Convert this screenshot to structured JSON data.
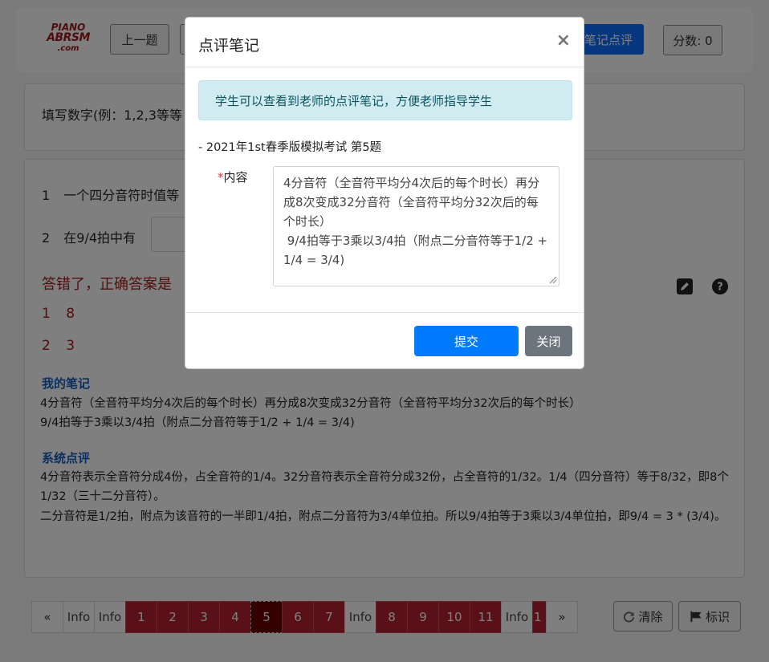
{
  "logo": {
    "line1": "PIANO",
    "line2": "ABRSM",
    "line3": ".com"
  },
  "toolbar": {
    "prev_label": "上一题",
    "notes_label": "笔记点评",
    "score_label": "分数: 0"
  },
  "question": {
    "instruction": "填写数字(例：1,2,3等等",
    "line1_num": "1",
    "line1_text": "一个四分音符时值等",
    "line2_num": "2",
    "line2_text": "在9/4拍中有",
    "wrong_text": "答错了，正确答案是",
    "answers": [
      "1 8",
      "2 3"
    ]
  },
  "notes": {
    "my_title": "我的笔记",
    "my_line1": "4分音符（全音符平均分4次后的每个时长）再分成8次变成32分音符（全音符平均分32次后的每个时长）",
    "my_line2": "9/4拍等于3乘以3/4拍（附点二分音符等于1/2 + 1/4 = 3/4)",
    "sys_title": "系统点评",
    "sys_line1": "4分音符表示全音符分成4份，占全音符的1/4。32分音符表示全音符分成32份，占全音符的1/32。1/4（四分音符）等于8/32，即8个1/32（三十二分音符）。",
    "sys_line2": "二分音符是1/2拍，附点为该音符的一半即1/4拍，附点二分音符为3/4单位拍。所以9/4拍等于3乘以3/4单位拍，即9/4 = 3 * (3/4)。"
  },
  "pager": {
    "prev": "«",
    "next": "»",
    "items": [
      "Info",
      "Info",
      "1",
      "2",
      "3",
      "4",
      "5",
      "6",
      "7",
      "Info",
      "8",
      "9",
      "10",
      "11",
      "Info",
      "1"
    ],
    "current": "5",
    "clear_label": "清除",
    "flag_label": "标识"
  },
  "modal": {
    "title": "点评笔记",
    "close": "×",
    "alert": "学生可以查看到老师的点评笔记，方便老师指导学生",
    "subtitle": "- 2021年1st春季版模拟考试 第5题",
    "field_star": "*",
    "field_label": "内容",
    "content": "4分音符（全音符平均分4次后的每个时长）再分成8次变成32分音符（全音符平均分32次后的每个时长）\n 9/4拍等于3乘以3/4拍（附点二分音符等于1/2 + 1/4 = 3/4)",
    "submit": "提交",
    "cancel": "关闭"
  }
}
